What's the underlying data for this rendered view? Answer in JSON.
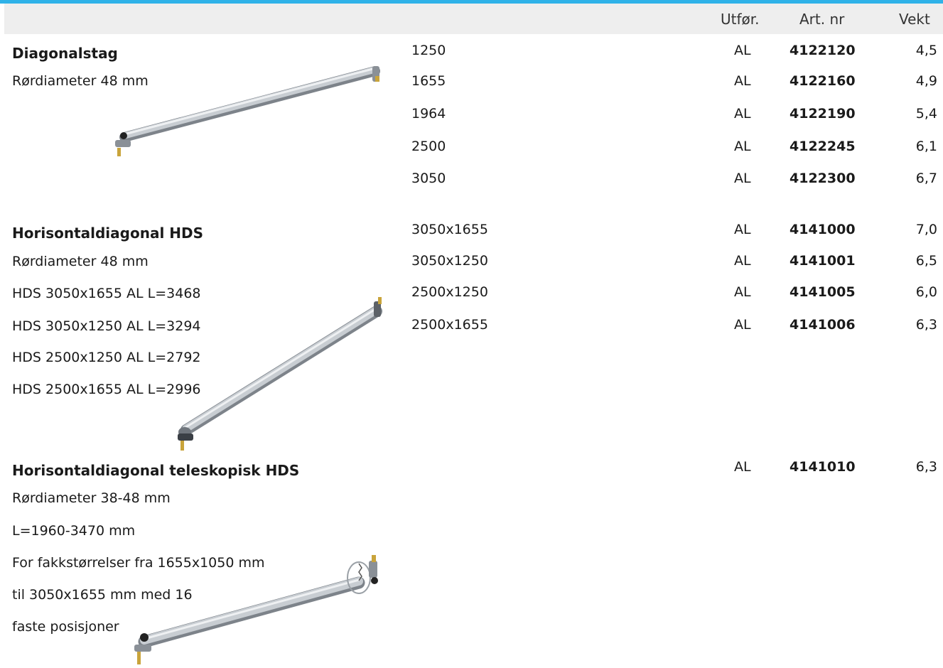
{
  "header": {
    "col_finish": "Utfør.",
    "col_artnr": "Art. nr",
    "col_weight": "Vekt"
  },
  "sections": [
    {
      "title": "Diagonalstag",
      "description": [
        "Rørdiameter 48 mm"
      ],
      "image_icon": "diagonal-brace-icon",
      "rows": [
        {
          "size": "1250",
          "finish": "AL",
          "artnr": "4122120",
          "weight": "4,5"
        },
        {
          "size": "1655",
          "finish": "AL",
          "artnr": "4122160",
          "weight": "4,9"
        },
        {
          "size": "1964",
          "finish": "AL",
          "artnr": "4122190",
          "weight": "5,4"
        },
        {
          "size": "2500",
          "finish": "AL",
          "artnr": "4122245",
          "weight": "6,1"
        },
        {
          "size": "3050",
          "finish": "AL",
          "artnr": "4122300",
          "weight": "6,7"
        }
      ]
    },
    {
      "title": "Horisontaldiagonal HDS",
      "description": [
        "Rørdiameter 48 mm",
        "HDS 3050x1655 AL L=3468",
        "HDS 3050x1250 AL L=3294",
        "HDS 2500x1250 AL L=2792",
        "HDS 2500x1655 AL L=2996"
      ],
      "image_icon": "horizontal-diagonal-icon",
      "rows": [
        {
          "size": "3050x1655",
          "finish": "AL",
          "artnr": "4141000",
          "weight": "7,0"
        },
        {
          "size": "3050x1250",
          "finish": "AL",
          "artnr": "4141001",
          "weight": "6,5"
        },
        {
          "size": "2500x1250",
          "finish": "AL",
          "artnr": "4141005",
          "weight": "6,0"
        },
        {
          "size": "2500x1655",
          "finish": "AL",
          "artnr": "4141006",
          "weight": "6,3"
        }
      ]
    },
    {
      "title": "Horisontaldiagonal teleskopisk HDS",
      "description": [
        "Rørdiameter 38-48 mm",
        "L=1960-3470 mm",
        "For fakkstørrelser fra 1655x1050 mm",
        "til 3050x1655 mm med 16",
        "faste posisjoner"
      ],
      "image_icon": "telescopic-diagonal-icon",
      "rows": [
        {
          "size": "",
          "finish": "AL",
          "artnr": "4141010",
          "weight": "6,3"
        }
      ]
    }
  ],
  "colors": {
    "accent": "#2fb2e8",
    "header_bg": "#eeeeee",
    "tube": "#b9bec4"
  }
}
